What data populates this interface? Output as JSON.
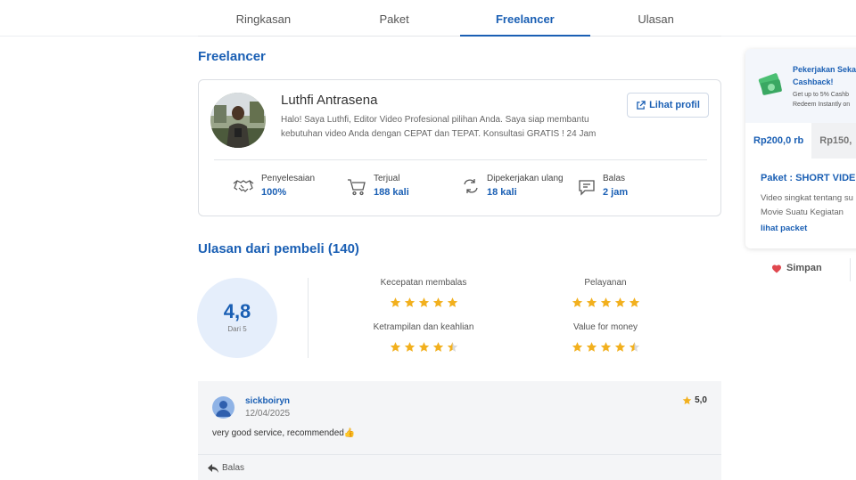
{
  "tabs": [
    {
      "label": "Ringkasan"
    },
    {
      "label": "Paket"
    },
    {
      "label": "Freelancer"
    },
    {
      "label": "Ulasan"
    }
  ],
  "freelancer_section": {
    "title": "Freelancer",
    "name": "Luthfi Antrasena",
    "description": "Halo! Saya Luthfi, Editor Video Profesional pilihan Anda. Saya siap membantu kebutuhan video Anda dengan CEPAT dan TEPAT. Konsultasi GRATIS ! 24 Jam",
    "profile_button": "Lihat profil",
    "stats": [
      {
        "label": "Penyelesaian",
        "value": "100%",
        "icon": "handshake-icon"
      },
      {
        "label": "Terjual",
        "value": "188 kali",
        "icon": "cart-icon"
      },
      {
        "label": "Dipekerjakan ulang",
        "value": "18 kali",
        "icon": "repeat-icon"
      },
      {
        "label": "Balas",
        "value": "2 jam",
        "icon": "chat-icon"
      }
    ]
  },
  "reviews_section": {
    "title": "Ulasan dari pembeli (140)",
    "score": "4,8",
    "score_sub": "Dari 5",
    "ratings": [
      {
        "label": "Kecepatan membalas",
        "stars": 5
      },
      {
        "label": "Pelayanan",
        "stars": 5
      },
      {
        "label": "Ketrampilan dan keahlian",
        "stars": 4.5
      },
      {
        "label": "Value for money",
        "stars": 4.5
      }
    ]
  },
  "review": {
    "user": "sickboiryn",
    "date": "12/04/2025",
    "score": "5,0",
    "text": "very good service, recommended👍",
    "reply_label": "Balas"
  },
  "sidebar": {
    "promo_title": "Pekerjakan Seka Cashback!",
    "promo_sub_1": "Get up to 5% Cashb",
    "promo_sub_2": "Redeem Instantly on",
    "price_tabs": [
      {
        "label": "Rp200,0 rb"
      },
      {
        "label": "Rp150,"
      }
    ],
    "package_title": "Paket : SHORT VIDE",
    "package_desc_1": "Video singkat tentang su",
    "package_desc_2": "Movie Suatu Kegiatan",
    "package_link": "lihat packet",
    "save_label": "Simpan"
  },
  "colors": {
    "accent": "#1a5fb4",
    "star": "#f2b01e",
    "heart": "#e0484f"
  }
}
